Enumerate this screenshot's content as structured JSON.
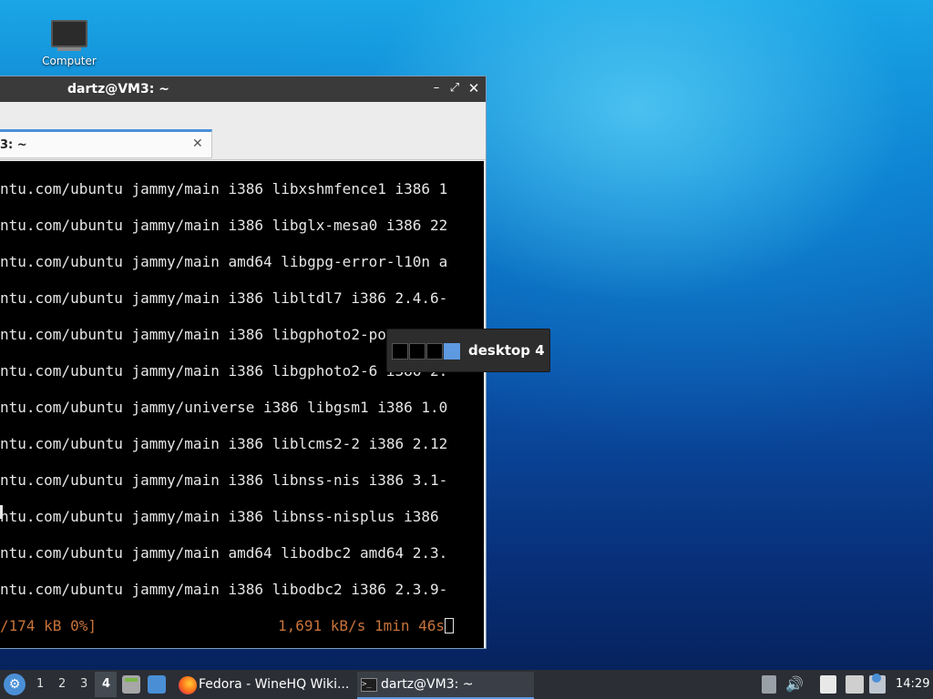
{
  "desktop": {
    "icons": [
      {
        "label": "Computer",
        "icon": "monitor-icon"
      }
    ]
  },
  "window": {
    "title": "dartz@VM3: ~",
    "controls": {
      "minimize": "–",
      "maximize": "⤢",
      "close": "✕"
    },
    "tab": {
      "label": "3: ~",
      "close": "✕"
    }
  },
  "terminal": {
    "lines": [
      "ntu.com/ubuntu jammy/main i386 libxshmfence1 i386 1",
      "ntu.com/ubuntu jammy/main i386 libglx-mesa0 i386 22",
      "ntu.com/ubuntu jammy/main amd64 libgpg-error-l10n a",
      "ntu.com/ubuntu jammy/main i386 libltdl7 i386 2.4.6-",
      "ntu.com/ubuntu jammy/main i386 libgphoto2-port12 i",
      "ntu.com/ubuntu jammy/main i386 libgphoto2-6 i386 2.",
      "ntu.com/ubuntu jammy/universe i386 libgsm1 i386 1.0",
      "ntu.com/ubuntu jammy/main i386 liblcms2-2 i386 2.12",
      "ntu.com/ubuntu jammy/main i386 libnss-nis i386 3.1-",
      "ntu.com/ubuntu jammy/main i386 libnss-nisplus i386",
      "ntu.com/ubuntu jammy/main amd64 libodbc2 amd64 2.3.",
      "ntu.com/ubuntu jammy/main i386 libodbc2 i386 2.3.9-"
    ],
    "progress_left": "/174 kB 0%]",
    "progress_right": "1,691 kB/s 1min 46s"
  },
  "osd": {
    "label": "desktop 4",
    "workspace_count": 4,
    "active_workspace": 4,
    "active_color": "#5d9ae0"
  },
  "taskbar": {
    "menu_icon": "fedora-icon",
    "workspaces": [
      "1",
      "2",
      "3",
      "4"
    ],
    "active_workspace": "4",
    "tasks": [
      {
        "label": "Fedora - WineHQ Wiki...",
        "icon": "firefox-icon"
      },
      {
        "label": "dartz@VM3: ~",
        "icon": "terminal-icon"
      }
    ],
    "clock": "14:29"
  }
}
